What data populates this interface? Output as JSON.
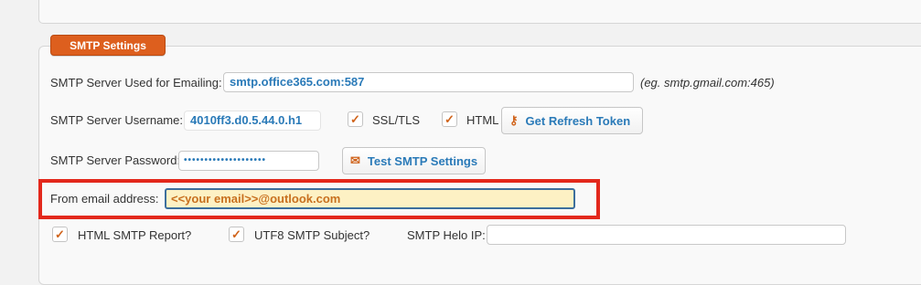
{
  "section": {
    "title": "SMTP Settings"
  },
  "server": {
    "label": "SMTP Server Used for Emailing:",
    "value": "smtp.office365.com:587",
    "hint": "(eg. smtp.gmail.com:465)"
  },
  "username": {
    "label": "SMTP Server Username:",
    "value": "4010ff3.d0.5.44.0.h1"
  },
  "ssl": {
    "label": "SSL/TLS",
    "checked": true
  },
  "html": {
    "label": "HTML",
    "checked": true
  },
  "refresh_button": {
    "label": "Get Refresh Token",
    "icon": "key-icon"
  },
  "password": {
    "label": "SMTP Server Password:",
    "value": "••••••••••••••••••••"
  },
  "test_button": {
    "label": "Test SMTP Settings",
    "icon": "envelope-icon"
  },
  "from_email": {
    "label": "From email address:",
    "value": "<<your email>>@outlook.com"
  },
  "html_report": {
    "label": "HTML SMTP Report?",
    "checked": true
  },
  "utf8_subject": {
    "label": "UTF8 SMTP Subject?",
    "checked": true
  },
  "helo_ip": {
    "label": "SMTP Helo IP:",
    "value": ""
  },
  "colors": {
    "accent": "#dd5f1e",
    "link": "#2a7ab8",
    "highlight": "#e3281c"
  }
}
